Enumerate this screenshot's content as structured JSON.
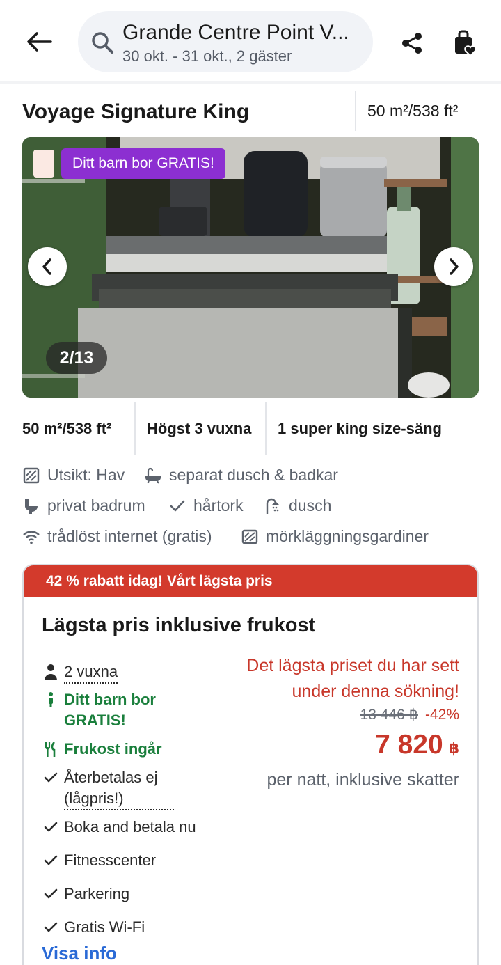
{
  "header": {
    "search_title": "Grande Centre Point V...",
    "search_subtitle": "30 okt. - 31 okt., 2 gäster",
    "icons": [
      "back-arrow-icon",
      "search-icon",
      "share-icon",
      "saved-bag-heart-icon"
    ]
  },
  "room": {
    "name": "Voyage Signature King",
    "size": "50 m²/538 ft²"
  },
  "gallery": {
    "badge": "Ditt barn bor GRATIS!",
    "counter": "2/13"
  },
  "facts": [
    "50 m²/538 ft²",
    "Högst 3 vuxna",
    "1 super king size-säng"
  ],
  "amenities": [
    {
      "label": "Utsikt: Hav",
      "icon": "view-icon"
    },
    {
      "label": "separat dusch & badkar",
      "icon": "bathtub-icon"
    },
    {
      "label": "privat badrum",
      "icon": "toilet-icon"
    },
    {
      "label": "hårtork",
      "icon": "check-icon"
    },
    {
      "label": "dusch",
      "icon": "shower-icon"
    },
    {
      "label": "trådlöst internet (gratis)",
      "icon": "wifi-icon"
    },
    {
      "label": "mörkläggningsgardiner",
      "icon": "blackout-curtain-icon"
    }
  ],
  "offer": {
    "banner": "42 % rabatt idag! Vårt lägsta pris",
    "title": "Lägsta pris inklusive frukost",
    "features": {
      "guests": "2 vuxna",
      "child": "Ditt barn bor GRATIS!",
      "breakfast": "Frukost ingår",
      "refund": "Återbetalas ej (lågpris!)",
      "pay": "Boka and betala nu",
      "fitness": "Fitnesscenter",
      "parking": "Parkering",
      "wifi": "Gratis Wi-Fi"
    },
    "more_info": "Visa info",
    "price_note": "Det lägsta priset du har sett under denna sökning!",
    "old_price": "13 446 ฿",
    "discount": "-42%",
    "price": "7 820",
    "currency": "฿",
    "price_sub": "per natt, inklusive skatter"
  },
  "colors": {
    "promo_purple": "#8c2fd1",
    "discount_red": "#d33a2c",
    "price_red": "#c8372a",
    "included_green": "#1a7f3c",
    "link_blue": "#2a6ad6"
  }
}
